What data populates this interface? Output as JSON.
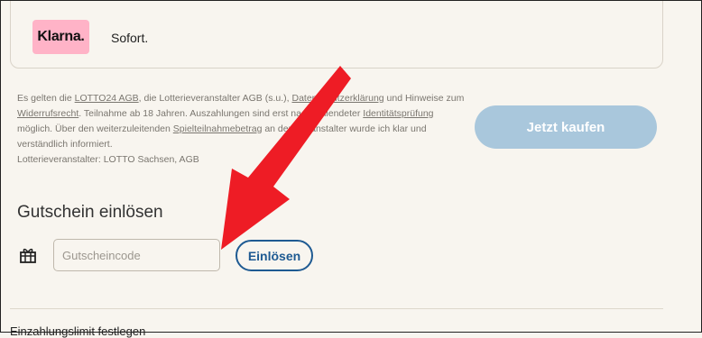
{
  "payment": {
    "logo_text": "Klarna.",
    "method_label": "Sofort."
  },
  "legal": {
    "p1": "Es gelten die ",
    "link_agb": "LOTTO24 AGB",
    "p2": ", die Lotterieveranstalter AGB (s.u.), ",
    "link_privacy": "Datenschutzerklärung",
    "p3": " und Hinweise zum ",
    "link_withdrawal": "Widerrufsrecht",
    "p4": ". Teilnahme ab 18 Jahren. Auszahlungen sind erst nach vollendeter ",
    "link_identity": "Identitätsprüfung",
    "p5": " möglich. Über den weiterzuleitenden ",
    "link_stake": "Spielteilnahmebetrag",
    "p6": " an den Veranstalter wurde ich klar und verständlich informiert.",
    "p7": "Lotterieveranstalter: LOTTO Sachsen, AGB"
  },
  "buy_button": "Jetzt kaufen",
  "voucher": {
    "title": "Gutschein einlösen",
    "placeholder": "Gutscheincode",
    "redeem_label": "Einlösen"
  },
  "bottom_text": "Einzahlungslimit festlegen",
  "colors": {
    "background": "#f8f5ef",
    "buy_button": "#a9c7dc",
    "redeem_border": "#1e5a92",
    "klarna_pink": "#ffb3c7",
    "arrow": "#ee1c25"
  }
}
